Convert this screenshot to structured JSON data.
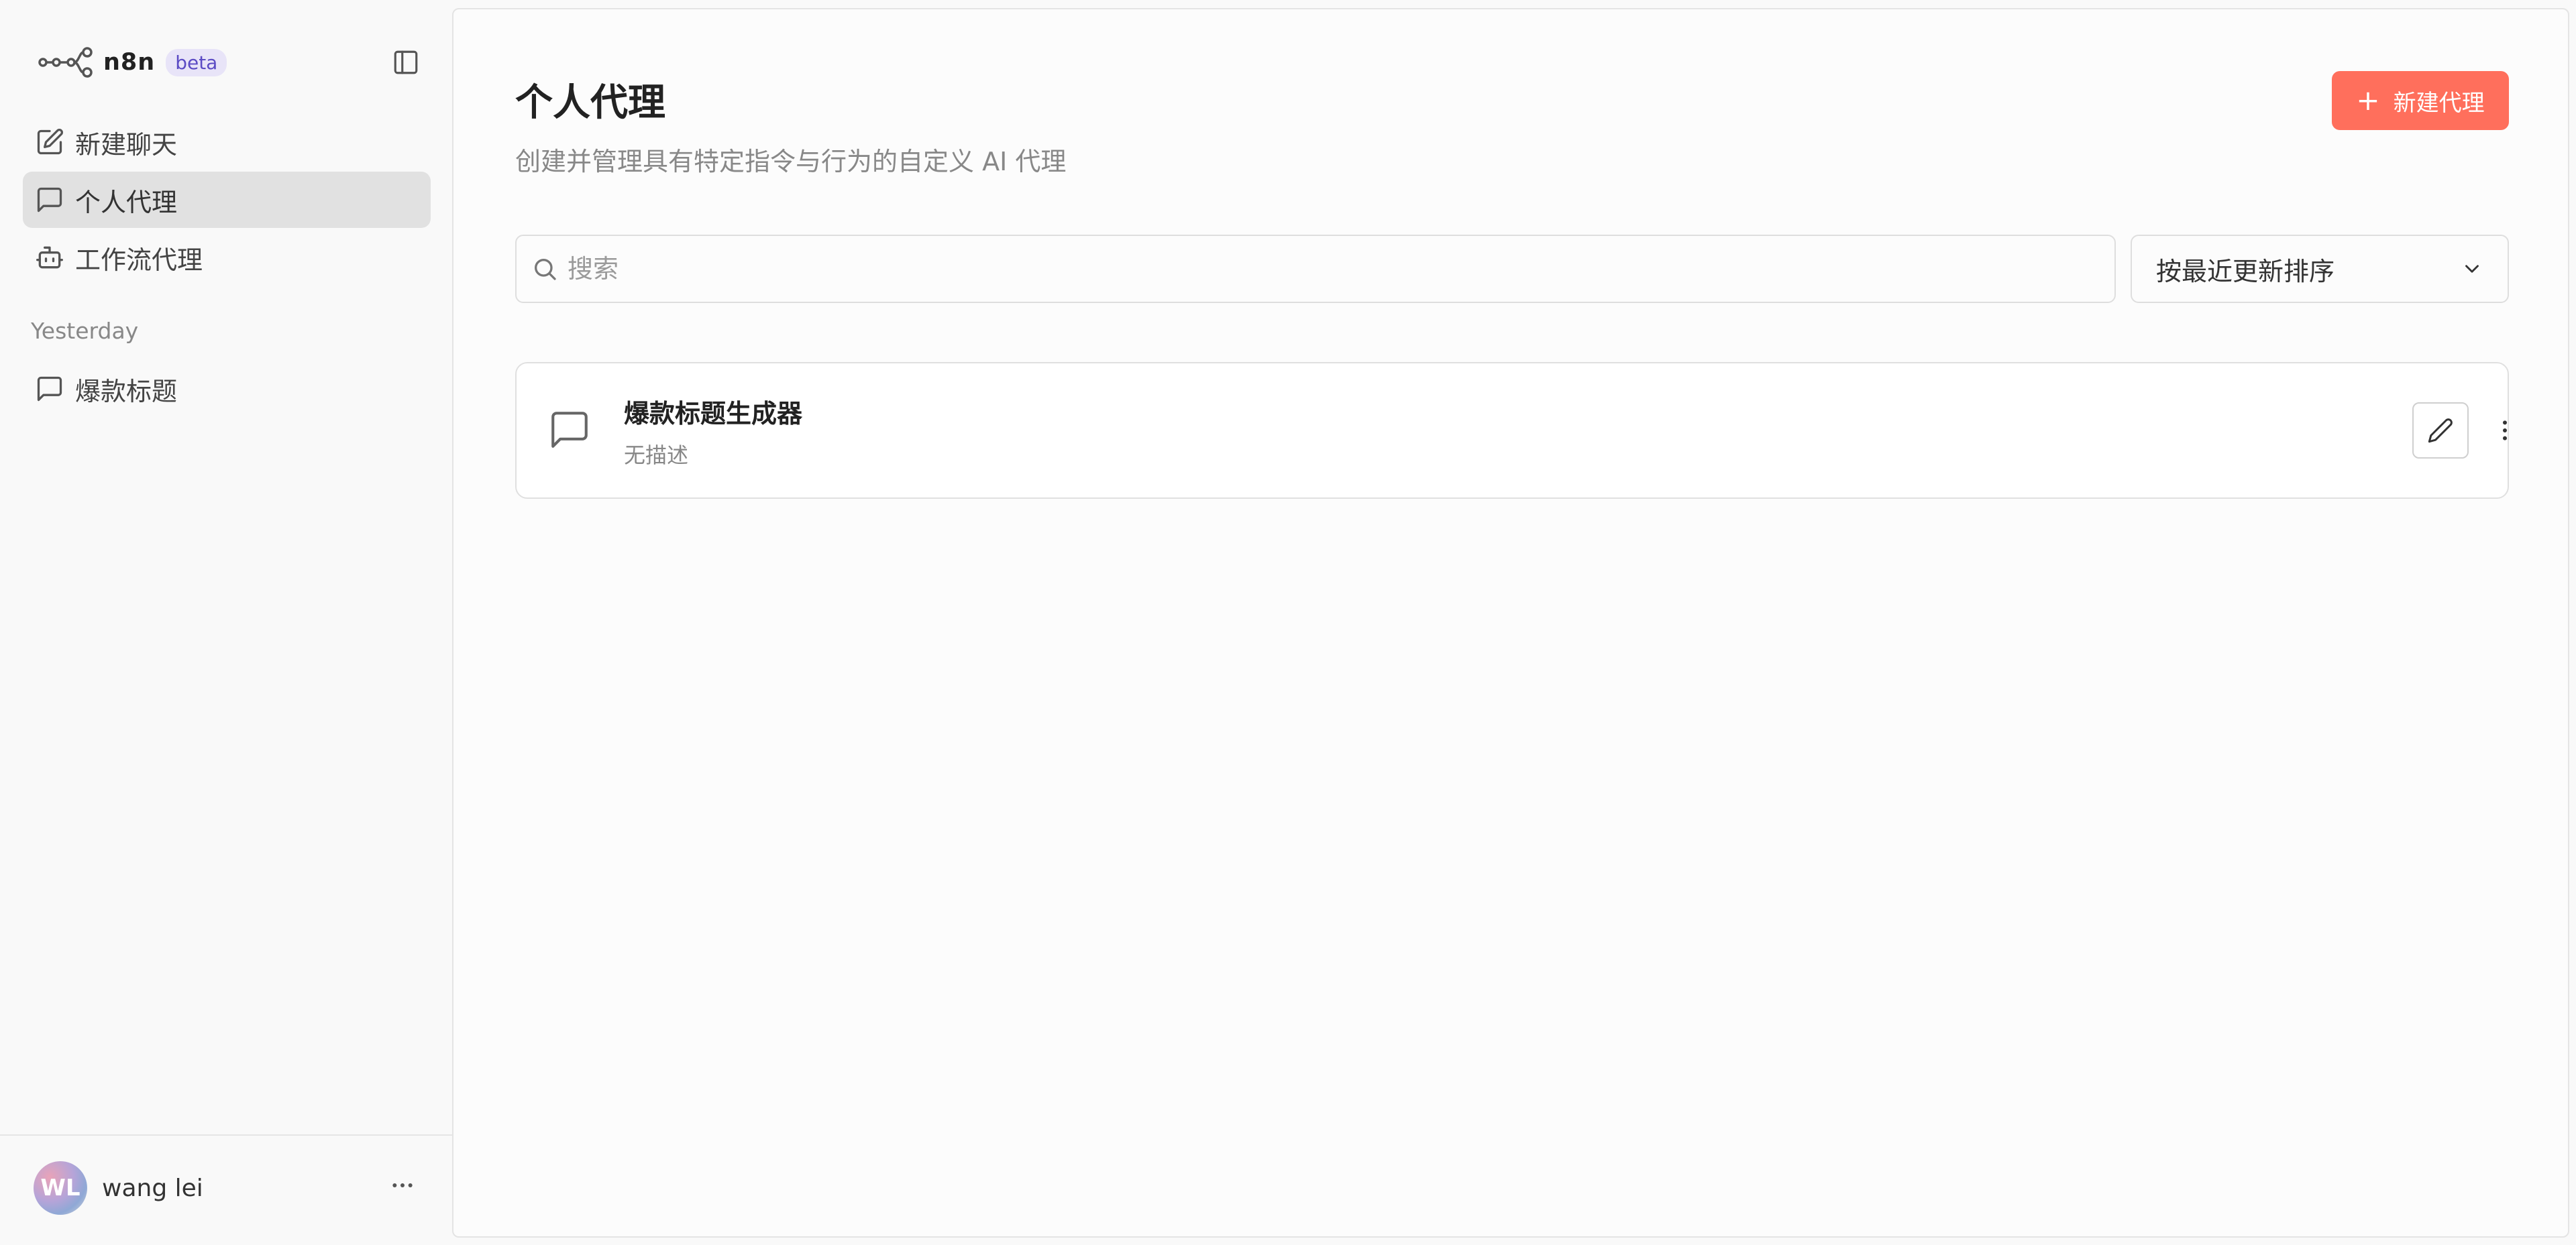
{
  "sidebar": {
    "brand_name": "n8n",
    "brand_badge": "beta",
    "nav": [
      {
        "label": "新建聊天",
        "icon": "edit-icon"
      },
      {
        "label": "个人代理",
        "icon": "chat-bubble-icon",
        "active": true
      },
      {
        "label": "工作流代理",
        "icon": "robot-icon"
      }
    ],
    "section_label": "Yesterday",
    "history": [
      {
        "label": "爆款标题",
        "icon": "chat-bubble-icon"
      }
    ],
    "user": {
      "initials": "WL",
      "name": "wang lei"
    }
  },
  "main": {
    "title": "个人代理",
    "subtitle": "创建并管理具有特定指令与行为的自定义 AI 代理",
    "new_button_label": "新建代理",
    "search": {
      "placeholder": "搜索",
      "value": ""
    },
    "sort": {
      "selected": "按最近更新排序"
    },
    "agents": [
      {
        "name": "爆款标题生成器",
        "description": "无描述"
      }
    ]
  },
  "colors": {
    "accent": "#ff6f5c",
    "active_nav_bg": "#e1e1e1",
    "badge_bg": "#e8e4f8",
    "badge_text": "#5b4bc4"
  }
}
